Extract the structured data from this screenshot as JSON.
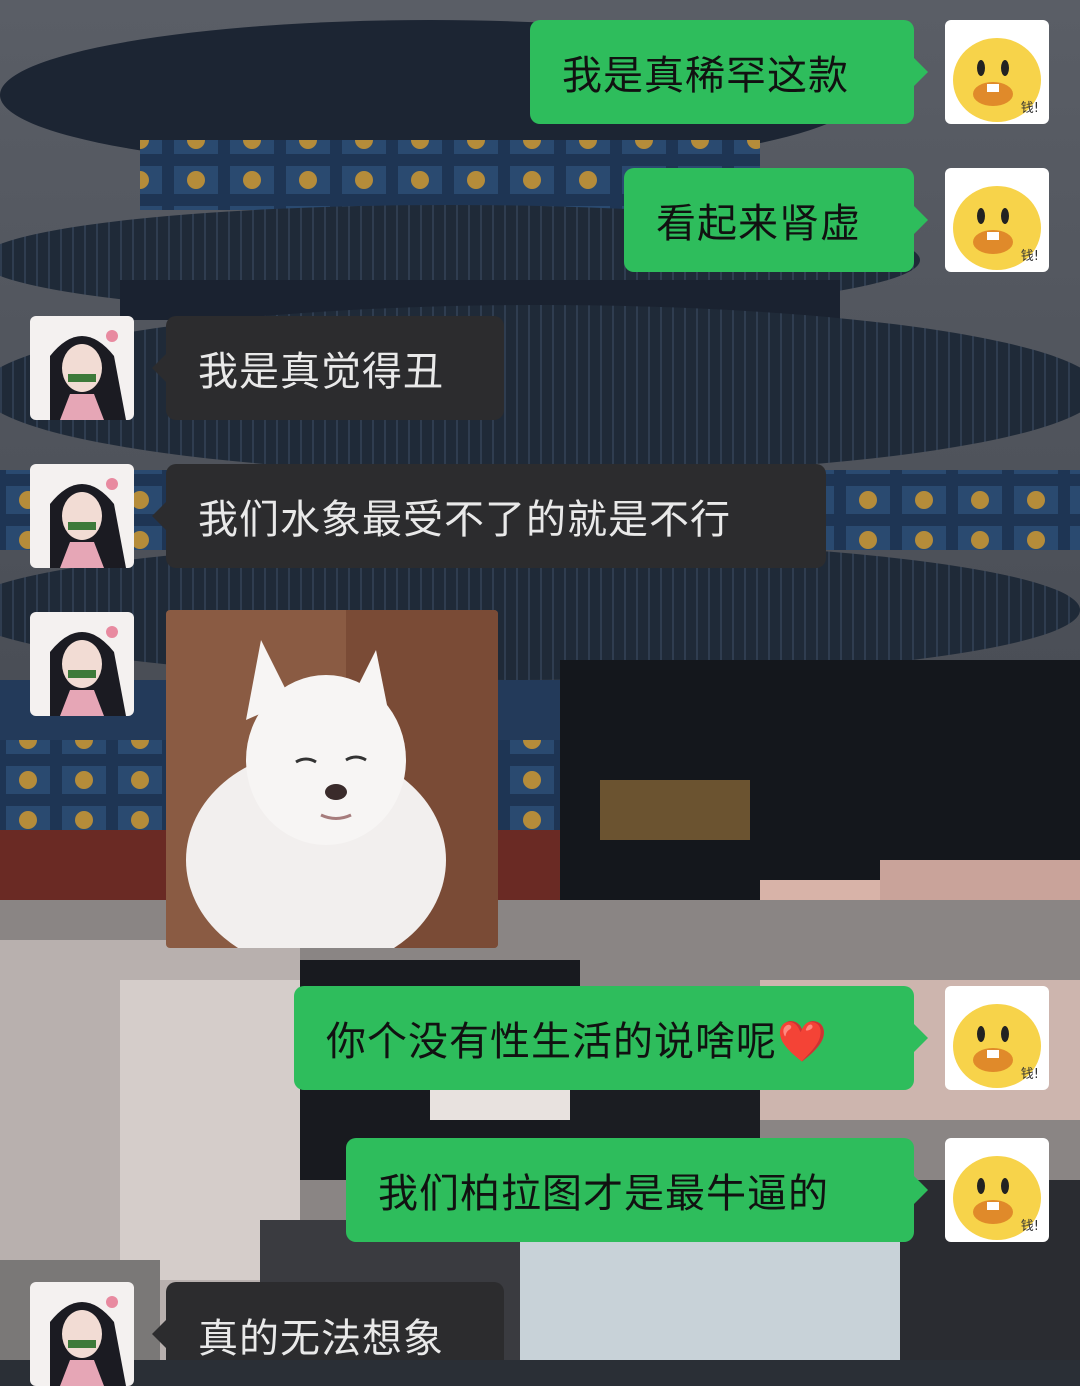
{
  "chat": {
    "messages": [
      {
        "side": "right",
        "type": "text",
        "text": "我是真稀罕这款"
      },
      {
        "side": "right",
        "type": "text",
        "text": "看起来肾虚"
      },
      {
        "side": "left",
        "type": "text",
        "text": "我是真觉得丑"
      },
      {
        "side": "left",
        "type": "text",
        "text": "我们水象最受不了的就是不行"
      },
      {
        "side": "left",
        "type": "image",
        "alt": "white fluffy dog sticker"
      },
      {
        "side": "right",
        "type": "text",
        "text": "你个没有性生活的说啥呢❤️"
      },
      {
        "side": "right",
        "type": "text",
        "text": "我们柏拉图才是最牛逼的"
      },
      {
        "side": "left",
        "type": "text",
        "text": "真的无法想象"
      }
    ],
    "my_avatar_badge": "钱!",
    "colors": {
      "mine_bubble": "#2ebd5c",
      "their_bubble": "#2c2c2e"
    }
  }
}
